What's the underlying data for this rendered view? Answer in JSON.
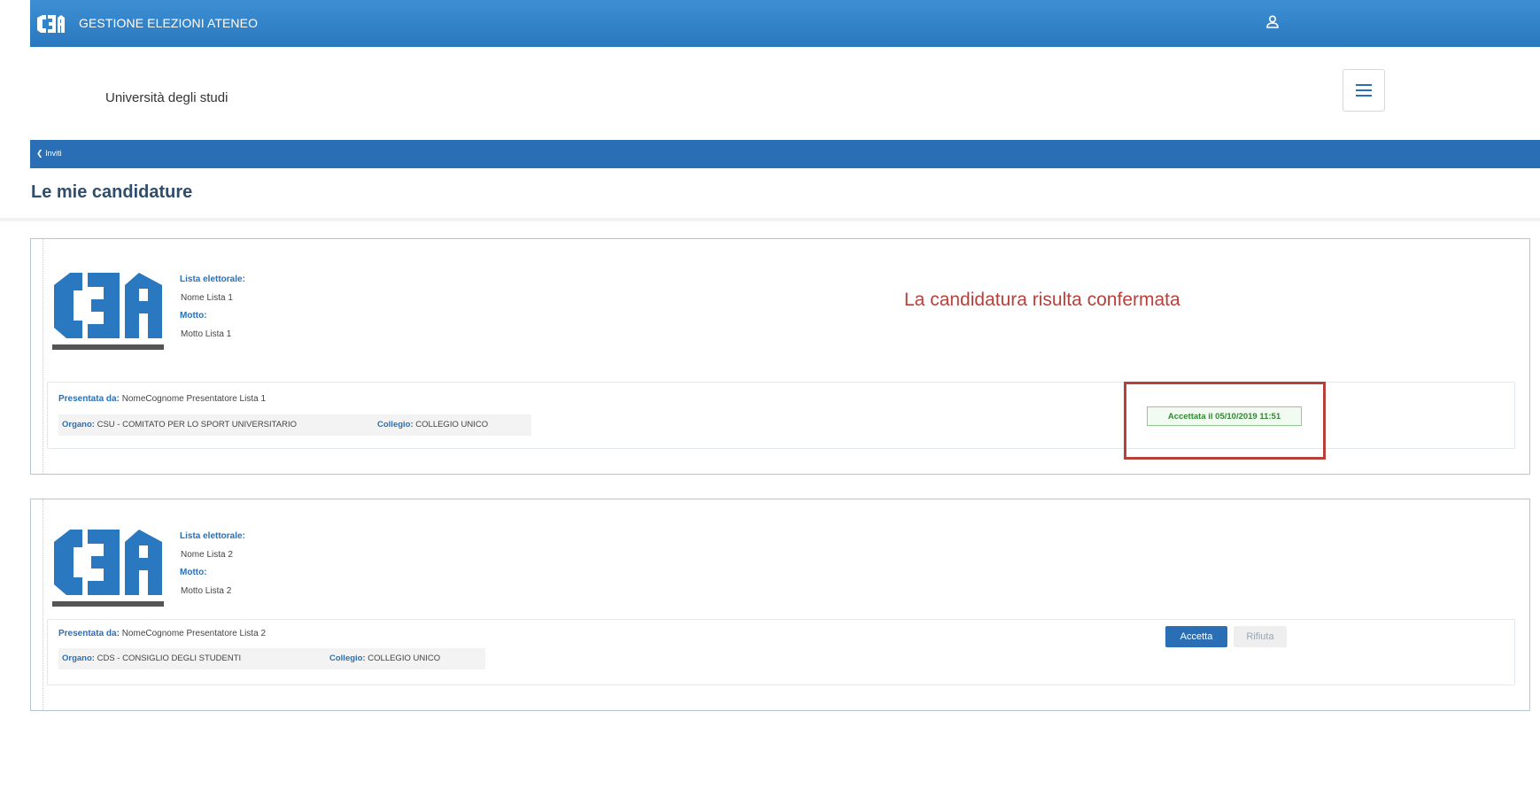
{
  "header": {
    "app_title": "GESTIONE ELEZIONI ATENEO",
    "logo_icon": "c3a-logo-icon",
    "user_icon": "user-icon"
  },
  "subheader": {
    "university": "Università degli studi",
    "menu_icon": "hamburger-menu-icon"
  },
  "breadcrumb": {
    "back_label": "Inviti",
    "back_icon": "chevron-left-icon"
  },
  "page": {
    "title": "Le mie candidature"
  },
  "labels": {
    "lista": "Lista elettorale:",
    "motto": "Motto:",
    "presentata": "Presentata da:",
    "organo": "Organo:",
    "collegio": "Collegio:"
  },
  "candidature": [
    {
      "lista": "Nome Lista 1",
      "motto": "Motto Lista 1",
      "presentatore": "NomeCognome Presentatore Lista 1",
      "organo": "CSU - COMITATO PER LO SPORT UNIVERSITARIO",
      "collegio": "COLLEGIO UNICO",
      "status": "Accettata il 05/10/2019 11:51"
    },
    {
      "lista": "Nome Lista 2",
      "motto": "Motto Lista 2",
      "presentatore": "NomeCognome Presentatore Lista 2",
      "organo": "CDS - CONSIGLIO DEGLI STUDENTI",
      "collegio": "COLLEGIO UNICO",
      "accept_label": "Accetta",
      "refuse_label": "Rifiuta"
    }
  ],
  "annotation": {
    "text": "La candidatura risulta confermata",
    "color": "#b8403a"
  },
  "colors": {
    "primary": "#2a6fb5",
    "topbar": "#3d8fd3",
    "success": "#2f8a2f"
  }
}
